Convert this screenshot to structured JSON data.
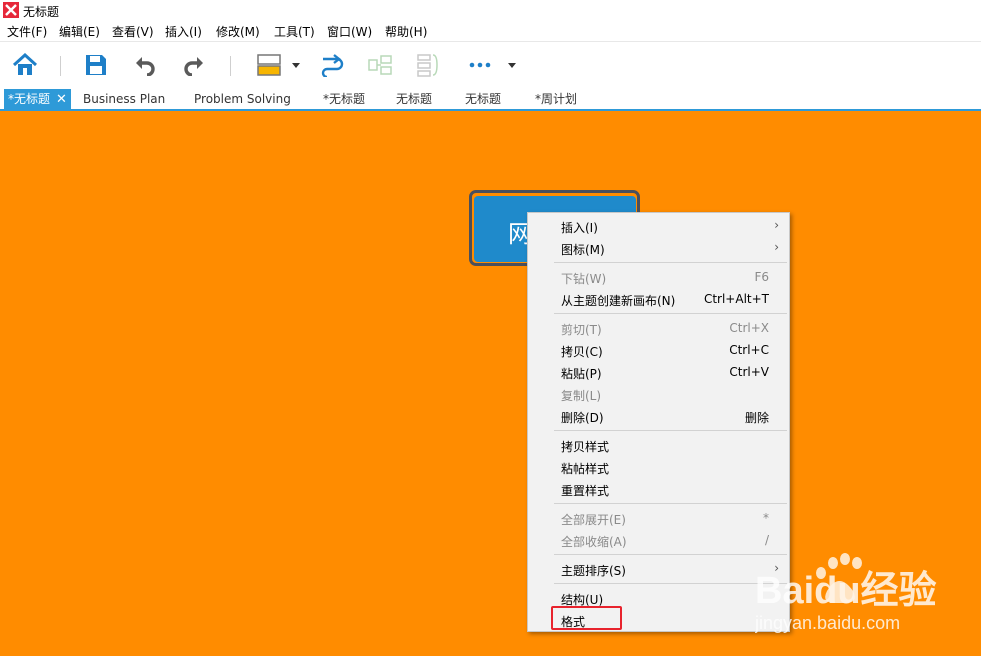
{
  "window": {
    "title": "无标题",
    "logo": "xmind-logo-icon"
  },
  "menubar": {
    "items": [
      "文件(F)",
      "编辑(E)",
      "查看(V)",
      "插入(I)",
      "修改(M)",
      "工具(T)",
      "窗口(W)",
      "帮助(H)"
    ]
  },
  "toolbar": {
    "icons": [
      "home-icon",
      "save-icon",
      "undo-icon",
      "redo-icon",
      "topic-style-icon",
      "relationship-icon",
      "boundary-icon",
      "summary-icon",
      "more-icon"
    ]
  },
  "tabs": [
    {
      "label": "*无标题",
      "close": "✕",
      "active": true
    },
    {
      "label": "Business Plan"
    },
    {
      "label": "Problem Solving"
    },
    {
      "label": "*无标题"
    },
    {
      "label": "无标题"
    },
    {
      "label": "无标题"
    },
    {
      "label": "*周计划"
    }
  ],
  "canvas": {
    "background": "#ff8c00",
    "central_topic_text": "网"
  },
  "context_menu": {
    "items": [
      {
        "label": "插入(I)",
        "submenu": true
      },
      {
        "label": "图标(M)",
        "submenu": true
      },
      {
        "label": "下钻(W)",
        "shortcut": "F6",
        "disabled": true
      },
      {
        "label": "从主题创建新画布(N)",
        "shortcut": "Ctrl+Alt+T"
      },
      {
        "label": "剪切(T)",
        "shortcut": "Ctrl+X",
        "disabled": true
      },
      {
        "label": "拷贝(C)",
        "shortcut": "Ctrl+C"
      },
      {
        "label": "粘贴(P)",
        "shortcut": "Ctrl+V"
      },
      {
        "label": "复制(L)",
        "disabled": true
      },
      {
        "label": "删除(D)",
        "shortcut": "删除"
      },
      {
        "label": "拷贝样式"
      },
      {
        "label": "粘帖样式"
      },
      {
        "label": "重置样式"
      },
      {
        "label": "全部展开(E)",
        "shortcut": "*",
        "disabled": true
      },
      {
        "label": "全部收缩(A)",
        "shortcut": "/",
        "disabled": true
      },
      {
        "label": "主题排序(S)",
        "submenu": true
      },
      {
        "label": "结构(U)"
      },
      {
        "label": "格式",
        "highlighted": true
      }
    ],
    "submenu_arrow": "›"
  },
  "watermark": {
    "text": "Baidu经验",
    "url_text": "jingyan.baidu.com"
  },
  "colors": {
    "accent": "#2e9ad8",
    "highlight_border": "#e8232d",
    "topic": "#1f8acb"
  }
}
